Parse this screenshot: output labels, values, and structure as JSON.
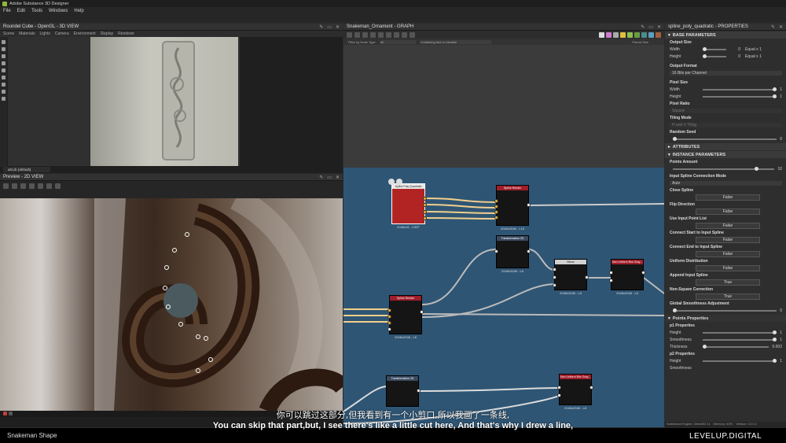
{
  "app": {
    "title": "Adobe Substance 3D Designer"
  },
  "menu": [
    "File",
    "Edit",
    "Tools",
    "Windows",
    "Help"
  ],
  "view3d": {
    "title": "Roundel Cube - OpenGL - 3D VIEW",
    "tabs": [
      "Scene",
      "Materials",
      "Lights",
      "Camera",
      "Environment",
      "Display",
      "Renderer"
    ],
    "env_select": "aKLib (default)"
  },
  "view2d": {
    "title": "Preview - 2D VIEW"
  },
  "graph": {
    "title": "Snakeman_Ornament - GRAPH",
    "filter_label": "Filter by Node Type",
    "filter_value": "All",
    "search_placeholder": "Containing text or variable",
    "parent_size": "Parent Size",
    "nodes": [
      {
        "name": "Spline Poly Quadratic",
        "size": "2048x16 - C32F"
      },
      {
        "name": "Spline Render",
        "size": "2048x2048 - L16"
      },
      {
        "name": "Transformation 2D",
        "size": "2048x2048 - L8"
      },
      {
        "name": "Blend",
        "size": "2048x2048 - L8"
      },
      {
        "name": "Non Uniform Blur Gray...",
        "size": "2048x2048 - L8"
      },
      {
        "name": "Spline Render",
        "size": "2048x2048 - L8"
      },
      {
        "name": "Transformation 2D",
        "size": ""
      },
      {
        "name": "Non Uniform Blur Gray...",
        "size": "2048x2048 - L8"
      }
    ]
  },
  "properties": {
    "title": "spline_poly_quadratic - PROPERTIES",
    "base_section": "BASE PARAMETERS",
    "output_size": {
      "label": "Output Size",
      "width_label": "Width",
      "width_val": "0",
      "width_mode": "Equal x 1",
      "height_label": "Height",
      "height_val": "0",
      "height_mode": "Equal x 1"
    },
    "output_format": {
      "label": "Output Format",
      "value": "16 Bits per Channel"
    },
    "pixel_size": {
      "label": "Pixel Size",
      "width_label": "Width",
      "width_val": "1",
      "height_label": "Height",
      "height_val": "1"
    },
    "pixel_ratio": {
      "label": "Pixel Ratio",
      "value": "Square"
    },
    "tiling": {
      "label": "Tiling Mode",
      "value": "H and V Tiling"
    },
    "random_seed": {
      "label": "Random Seed",
      "value": "0"
    },
    "attributes": "ATTRIBUTES",
    "instance_section": "INSTANCE PARAMETERS",
    "points_amount": {
      "label": "Points Amount",
      "value": "10"
    },
    "input_conn": {
      "label": "Input Spline Connection Mode",
      "value": "Auto"
    },
    "close_spline": {
      "label": "Close Spline",
      "value": "False"
    },
    "flip_direction": {
      "label": "Flip Direction",
      "value": "False"
    },
    "use_input_point": {
      "label": "Use Input Point List",
      "value": "False"
    },
    "connect_start": {
      "label": "Connect Start to Input Spline",
      "value": "False"
    },
    "connect_end": {
      "label": "Connect End to Input Spline",
      "value": "False"
    },
    "uniform_dist": {
      "label": "Uniform Distribution",
      "value": "False"
    },
    "append_input": {
      "label": "Append Input Spline",
      "value": "True"
    },
    "non_square": {
      "label": "Non-Square Correction",
      "value": "True"
    },
    "global_smooth": {
      "label": "Global Smoothness Adjustment",
      "value": "0"
    },
    "points_props": "Points Properties",
    "p1": {
      "label": "p1 Properties",
      "height_label": "Height",
      "height_val": "1",
      "smooth_label": "Smoothness",
      "smooth_val": "1",
      "thickness_label": "Thickness",
      "thickness_val": "0.002"
    },
    "p2": {
      "label": "p2 Properties",
      "height_label": "Height",
      "height_val": "1",
      "smooth_label": "Smoothness"
    }
  },
  "status": {
    "engine": "Substance Engine: Direct3D 11",
    "memory": "Memory: 63%",
    "version": "Version: 13.0.2"
  },
  "subtitle_cn": "你可以跳过这部分,但我看到有一个小剪口,所以我画了一条线,",
  "subtitle_en": "You can skip that part,but, I see there's like a little cut here, And that's why I drew a line,",
  "footer_title": "Snakeman Shape",
  "watermark": "LEVELUP.DIGITAL"
}
